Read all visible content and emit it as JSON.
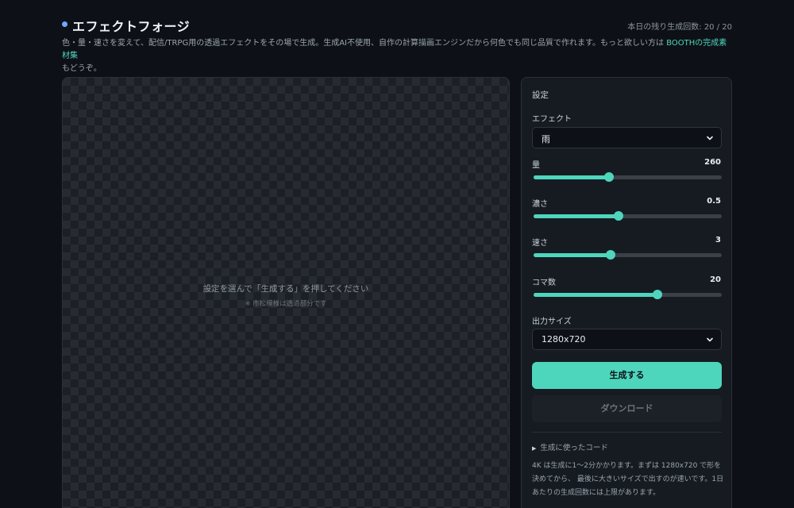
{
  "header": {
    "title": "エフェクトフォージ",
    "remaining": "本日の残り生成回数: 20 / 20"
  },
  "description": {
    "text": "色・量・速さを変えて、配信/TRPG用の透過エフェクトをその場で生成。生成AI不使用、自作の計算描画エンジンだから何色でも同じ品質で作れます。もっと欲しい方は",
    "link": "BOOTHの完成素材集",
    "tail": "もどうぞ。"
  },
  "preview": {
    "message": "設定を選んで「生成する」を押してください",
    "note": "※ 市松模様は透過部分です"
  },
  "settings": {
    "title": "設定",
    "effect": {
      "label": "エフェクト",
      "value": "雨"
    },
    "amount": {
      "label": "量",
      "value": "260",
      "fraction": 0.4
    },
    "density": {
      "label": "濃さ",
      "value": "0.5",
      "fraction": 0.45
    },
    "speed": {
      "label": "速さ",
      "value": "3",
      "fraction": 0.41
    },
    "frames": {
      "label": "コマ数",
      "value": "20",
      "fraction": 0.66
    },
    "output_size": {
      "label": "出力サイズ",
      "value": "1280x720"
    },
    "generate_label": "生成する",
    "download_label": "ダウンロード",
    "code_toggle": "生成に使ったコード",
    "info": "4K は生成に1〜2分かかります。まずは 1280x720 で形を決めてから、 最後に大きいサイズで出すのが速いです。1日あたりの生成回数には上限があります。"
  },
  "colors": {
    "accent": "#4ed6bd",
    "background": "#0d1117",
    "panel": "#161b22"
  }
}
